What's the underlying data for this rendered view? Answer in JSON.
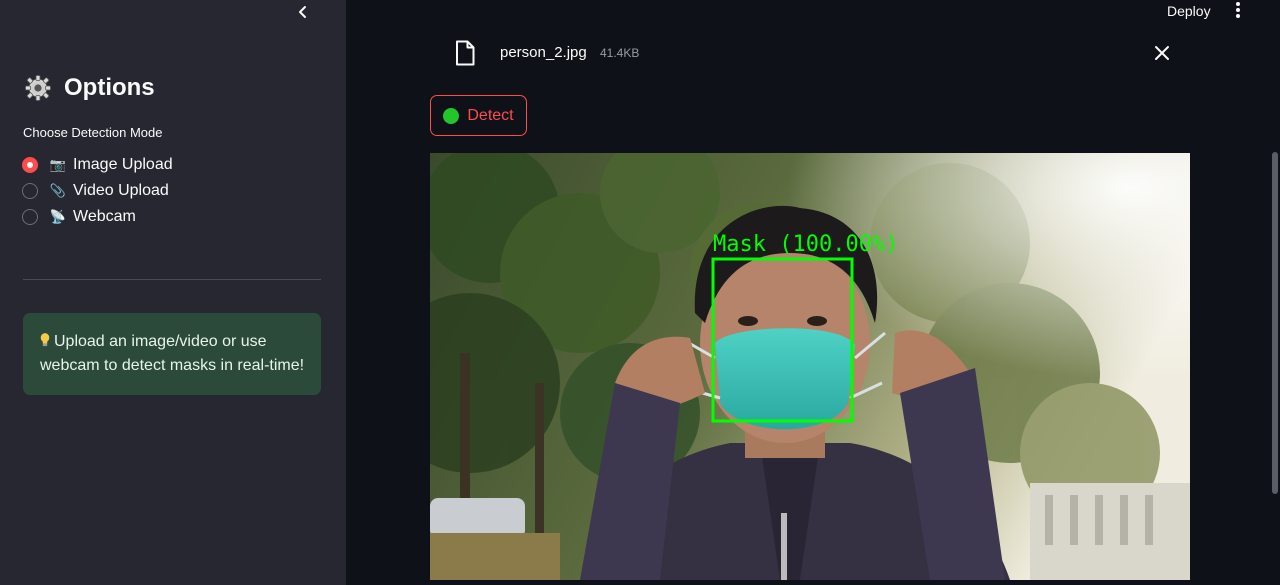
{
  "sidebar": {
    "title": "Options",
    "mode_label": "Choose Detection Mode",
    "modes": [
      {
        "emoji": "📷",
        "label": "Image Upload",
        "selected": true
      },
      {
        "emoji": "📎",
        "label": "Video Upload",
        "selected": false
      },
      {
        "emoji": "📡",
        "label": "Webcam",
        "selected": false
      }
    ],
    "info_text": "Upload an image/video or use webcam to detect masks in real-time!",
    "info_color": "#2c4a3a"
  },
  "header": {
    "deploy_label": "Deploy"
  },
  "file": {
    "name": "person_2.jpg",
    "size": "41.4KB"
  },
  "detect_button": {
    "label": "Detect",
    "accent": "#ff4b4b",
    "dot_color": "#22c52a"
  },
  "detection": {
    "label": "Mask (100.00%)",
    "box_color": "#00ff00"
  }
}
